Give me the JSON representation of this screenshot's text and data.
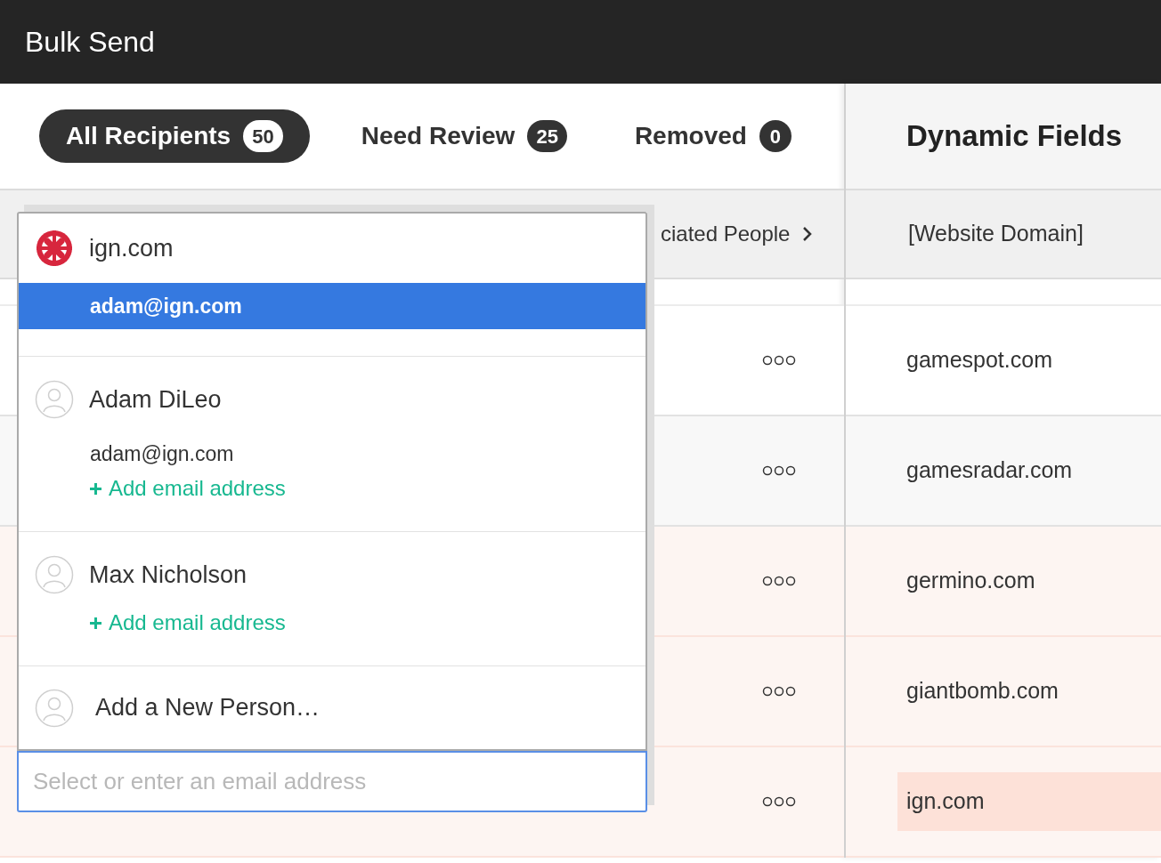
{
  "header": {
    "title": "Bulk Send"
  },
  "tabs": [
    {
      "label": "All Recipients",
      "count": "50",
      "selected": true
    },
    {
      "label": "Need Review",
      "count": "25",
      "selected": false
    },
    {
      "label": "Removed",
      "count": "0",
      "selected": false
    }
  ],
  "table": {
    "column_header": "ciated People",
    "rows": [
      {
        "flagged": false
      },
      {
        "flagged": false
      },
      {
        "flagged": true
      },
      {
        "flagged": true
      },
      {
        "flagged": true
      }
    ]
  },
  "dynamic_fields": {
    "title": "Dynamic Fields",
    "column_header": "[Website Domain]",
    "rows": [
      {
        "value": "gamespot.com",
        "highlighted": false
      },
      {
        "value": "gamesradar.com",
        "highlighted": false
      },
      {
        "value": "germino.com",
        "highlighted": false
      },
      {
        "value": "giantbomb.com",
        "highlighted": false
      },
      {
        "value": "ign.com",
        "highlighted": true
      }
    ]
  },
  "dropdown": {
    "groups": [
      {
        "kind": "company",
        "title": "ign.com",
        "emails": [
          {
            "text": "adam@ign.com",
            "selected": true
          }
        ]
      },
      {
        "kind": "person",
        "title": "Adam DiLeo",
        "emails": [
          {
            "text": "adam@ign.com",
            "selected": false
          }
        ],
        "add_email": "Add email address"
      },
      {
        "kind": "person",
        "title": "Max Nicholson",
        "add_email": "Add email address"
      },
      {
        "kind": "new",
        "title": "Add a New Person…"
      }
    ],
    "input": {
      "placeholder": "Select or enter an email address"
    }
  }
}
